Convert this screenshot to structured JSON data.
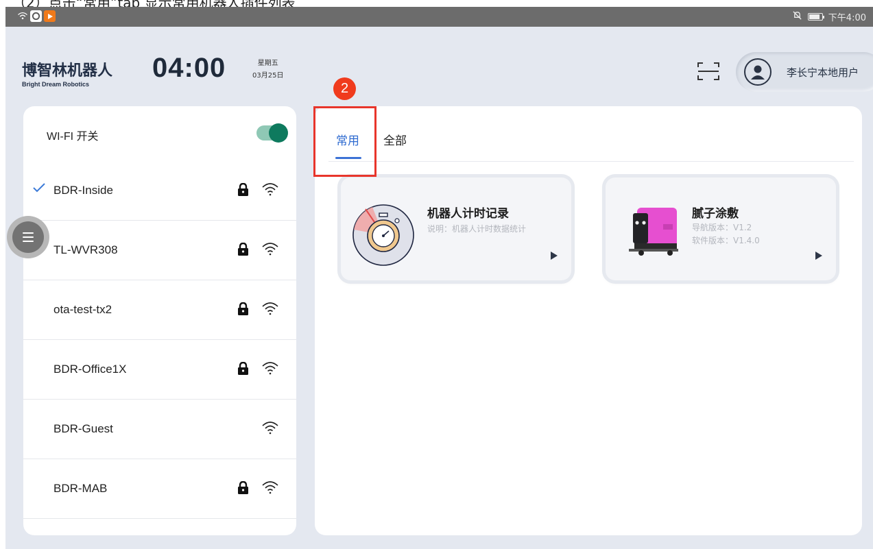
{
  "caption": "（2）点击“常用”tab 显示常用机器人插件列表",
  "statusbar": {
    "time": "下午4:00"
  },
  "header": {
    "logo_cn": "博智林机器人",
    "logo_en": "Bright Dream Robotics",
    "clock": "04:00",
    "weekday": "星期五",
    "date": "03月25日",
    "user_name": "李长宁本地用户"
  },
  "wifi": {
    "toggle_label": "WI-FI 开关",
    "toggle_on": true,
    "networks": [
      {
        "name": "BDR-Inside",
        "connected": true,
        "locked": true
      },
      {
        "name": "TL-WVR308",
        "connected": false,
        "locked": true
      },
      {
        "name": "ota-test-tx2",
        "connected": false,
        "locked": true
      },
      {
        "name": "BDR-Office1X",
        "connected": false,
        "locked": true
      },
      {
        "name": "BDR-Guest",
        "connected": false,
        "locked": false
      },
      {
        "name": "BDR-MAB",
        "connected": false,
        "locked": true
      }
    ]
  },
  "tabs": {
    "common": "常用",
    "all": "全部",
    "active": "common"
  },
  "annotation": {
    "step": "2"
  },
  "plugins": [
    {
      "title": "机器人计时记录",
      "line1": "说明：机器人计时数据统计"
    },
    {
      "title": "腻子涂敷",
      "line1": "导航版本：V1.2",
      "line2": "软件版本：V1.4.0"
    }
  ],
  "colors": {
    "accent": "#3d72d6",
    "toggle": "#0e7a5e",
    "annotation": "#e8352b",
    "robot": "#e64fd0"
  }
}
